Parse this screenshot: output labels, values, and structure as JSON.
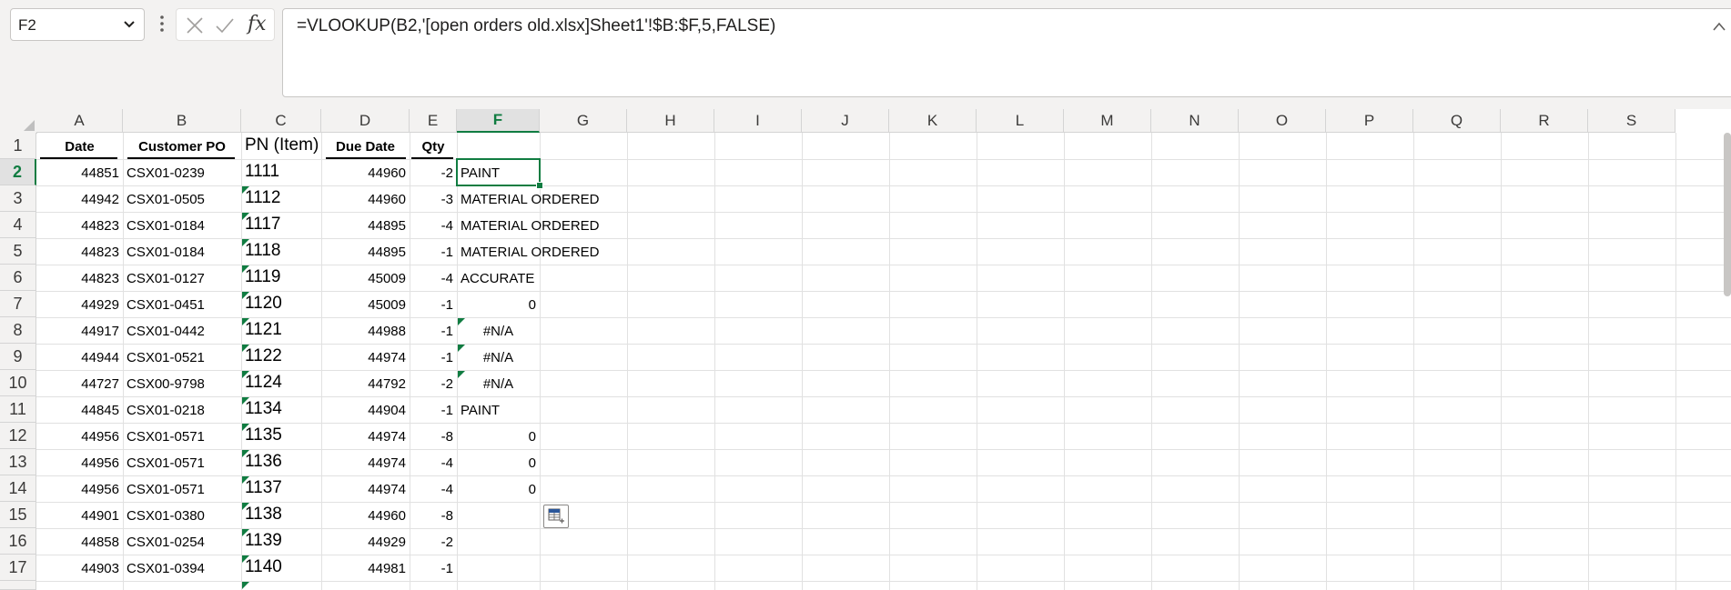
{
  "name_box": {
    "value": "F2"
  },
  "formula_bar": {
    "formula": "=VLOOKUP(B2,'[open orders old.xlsx]Sheet1'!$B:$F,5,FALSE)",
    "fx_label": "fx"
  },
  "columns": [
    "A",
    "B",
    "C",
    "D",
    "E",
    "F",
    "G",
    "H",
    "I",
    "J",
    "K",
    "L",
    "M",
    "N",
    "O",
    "P",
    "Q",
    "R",
    "S"
  ],
  "active_column": "F",
  "rows": [
    "1",
    "2",
    "3",
    "4",
    "5",
    "6",
    "7",
    "8",
    "9",
    "10",
    "11",
    "12",
    "13",
    "14",
    "15",
    "16",
    "17"
  ],
  "active_row": "2",
  "headers": {
    "date": "Date",
    "customer_po": "Customer PO",
    "pn_item": "PN (Item)",
    "due_date": "Due Date",
    "qty": "Qty"
  },
  "data_rows": [
    {
      "date": "44851",
      "po": "CSX01-0239",
      "pn": "1111",
      "due": "44960",
      "qty": "-2",
      "f": "PAINT"
    },
    {
      "date": "44942",
      "po": "CSX01-0505",
      "pn": "1112",
      "due": "44960",
      "qty": "-3",
      "f": "MATERIAL ORDERED"
    },
    {
      "date": "44823",
      "po": "CSX01-0184",
      "pn": "1117",
      "due": "44895",
      "qty": "-4",
      "f": "MATERIAL ORDERED"
    },
    {
      "date": "44823",
      "po": "CSX01-0184",
      "pn": "1118",
      "due": "44895",
      "qty": "-1",
      "f": "MATERIAL ORDERED"
    },
    {
      "date": "44823",
      "po": "CSX01-0127",
      "pn": "1119",
      "due": "45009",
      "qty": "-4",
      "f": "ACCURATE"
    },
    {
      "date": "44929",
      "po": "CSX01-0451",
      "pn": "1120",
      "due": "45009",
      "qty": "-1",
      "f": "0"
    },
    {
      "date": "44917",
      "po": "CSX01-0442",
      "pn": "1121",
      "due": "44988",
      "qty": "-1",
      "f": "#N/A"
    },
    {
      "date": "44944",
      "po": "CSX01-0521",
      "pn": "1122",
      "due": "44974",
      "qty": "-1",
      "f": "#N/A"
    },
    {
      "date": "44727",
      "po": "CSX00-9798",
      "pn": "1124",
      "due": "44792",
      "qty": "-2",
      "f": "#N/A"
    },
    {
      "date": "44845",
      "po": "CSX01-0218",
      "pn": "1134",
      "due": "44904",
      "qty": "-1",
      "f": "PAINT"
    },
    {
      "date": "44956",
      "po": "CSX01-0571",
      "pn": "1135",
      "due": "44974",
      "qty": "-8",
      "f": "0"
    },
    {
      "date": "44956",
      "po": "CSX01-0571",
      "pn": "1136",
      "due": "44974",
      "qty": "-4",
      "f": "0"
    },
    {
      "date": "44956",
      "po": "CSX01-0571",
      "pn": "1137",
      "due": "44974",
      "qty": "-4",
      "f": "0"
    },
    {
      "date": "44901",
      "po": "CSX01-0380",
      "pn": "1138",
      "due": "44960",
      "qty": "-8",
      "f": ""
    },
    {
      "date": "44858",
      "po": "CSX01-0254",
      "pn": "1139",
      "due": "44929",
      "qty": "-2",
      "f": ""
    },
    {
      "date": "44903",
      "po": "CSX01-0394",
      "pn": "1140",
      "due": "44981",
      "qty": "-1",
      "f": ""
    }
  ],
  "colors": {
    "accent": "#107c41",
    "header_bg": "#f3f2f1",
    "gridline": "#e1e1e1"
  }
}
